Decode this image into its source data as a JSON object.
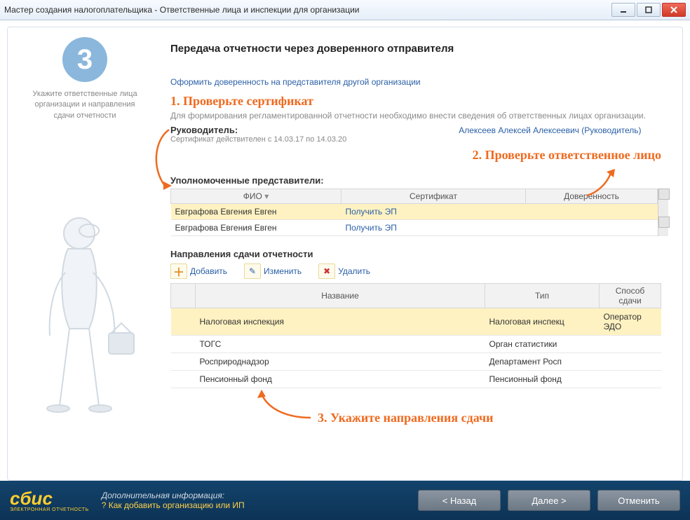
{
  "window": {
    "title": "Мастер создания налогоплательщика - Ответственные лица и инспекции для организации"
  },
  "sidebar": {
    "step_number": "3",
    "hint": "Укажите ответственные лица организации и направления сдачи отчетности"
  },
  "main": {
    "heading": "Передача отчетности через доверенного отправителя",
    "trust_link": "Оформить доверенность на представителя другой организации",
    "info_text": "Для формирования регламентированной отчетности необходимо внести сведения об ответственных лицах организации.",
    "director_label": "Руководитель:",
    "cert_text": "Сертификат действителен с 14.03.17 по 14.03.20",
    "director_name": "Алексеев Алексей Алексеевич (Руководитель)",
    "reps_heading": "Уполномоченные представители:",
    "reps_cols": {
      "fio": "ФИО",
      "cert": "Сертификат",
      "trust": "Доверенность"
    },
    "reps": [
      {
        "fio": "Евграфова Евгения Евген",
        "cert": "Получить ЭП",
        "trust": ""
      },
      {
        "fio": "Евграфова Евгения Евген",
        "cert": "Получить ЭП",
        "trust": ""
      }
    ],
    "dirs_heading": "Направления сдачи отчетности",
    "toolbar": {
      "add": "Добавить",
      "edit": "Изменить",
      "del": "Удалить"
    },
    "dirs_cols": {
      "name": "Название",
      "type": "Тип",
      "method": "Способ сдачи"
    },
    "dirs": [
      {
        "name": "Налоговая инспекция",
        "type": "Налоговая инспекц",
        "method": "Оператор ЭДО"
      },
      {
        "name": "ТОГС",
        "type": "Орган статистики",
        "method": ""
      },
      {
        "name": "Росприроднадзор",
        "type": "Департамент Росп",
        "method": ""
      },
      {
        "name": "Пенсионный фонд",
        "type": "Пенсионный фонд",
        "method": ""
      }
    ]
  },
  "annotations": {
    "a1": "1. Проверьте сертификат",
    "a2": "2. Проверьте ответственное лицо",
    "a3": "3. Укажите направления сдачи"
  },
  "footer": {
    "extra_label": "Дополнительная информация:",
    "help_link": "Как добавить организацию или ИП",
    "back": "< Назад",
    "next": "Далее >",
    "cancel": "Отменить",
    "logo": "сбис",
    "logo_sub": "ЭЛЕКТРОННАЯ ОТЧЕТНОСТЬ"
  }
}
